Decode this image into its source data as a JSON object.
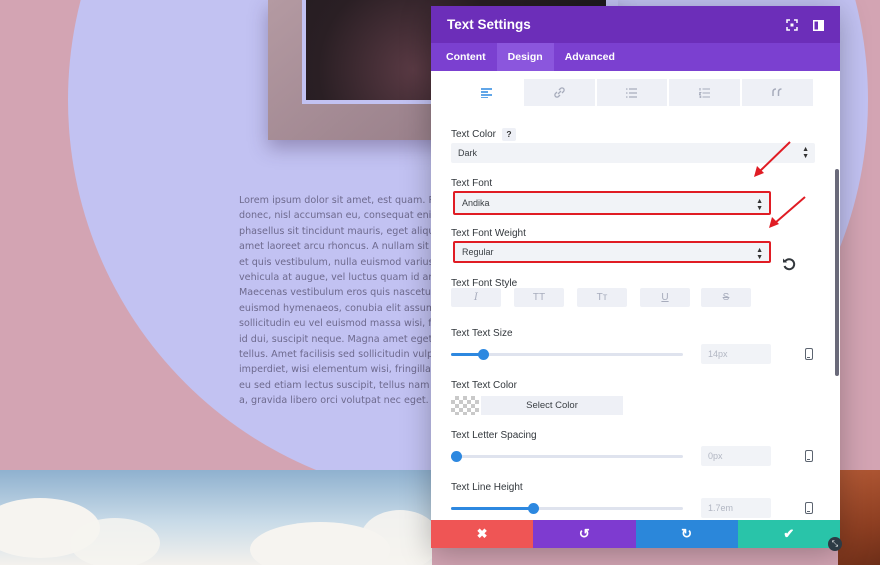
{
  "background": {
    "lorem_lines": [
      "Lorem ipsum dolor sit amet, est quam. Porta",
      "donec, nisl accumsan eu, consequat enim no",
      "phasellus sit tincidunt mauris, eget aliquam",
      "amet laoreet arcu rhoncus. A nullam sit cur",
      "et quis vestibulum, nulla euismod varius",
      "vehicula at augue, vel luctus quam id ante.",
      "Maecenas vestibulum eros quis nascetur",
      "euismod hymenaeos, conubia elit assumenda",
      "sollicitudin eu vel euismod massa wisi, facilis",
      "id dui, suscipit neque. Magna amet eget quam",
      "tellus. Amet facilisis sed sollicitudin vulputat",
      "imperdiet, wisi elementum wisi, fringilla solu",
      "eu sed etiam lectus suscipit, tellus nam non p",
      "a, gravida libero orci volutpat nec eget."
    ]
  },
  "modal": {
    "title": "Text Settings",
    "tabs": [
      {
        "label": "Content"
      },
      {
        "label": "Design"
      },
      {
        "label": "Advanced"
      }
    ],
    "active_tab": "Design",
    "subtab_icons": [
      "align-left-icon",
      "link-icon",
      "list-icon",
      "ordered-list-icon",
      "quote-icon"
    ],
    "text_color": {
      "label": "Text Color",
      "help": "?",
      "value": "Dark"
    },
    "text_font": {
      "label": "Text Font",
      "value": "Andika"
    },
    "text_font_weight": {
      "label": "Text Font Weight",
      "value": "Regular"
    },
    "text_font_style": {
      "label": "Text Font Style",
      "buttons": [
        "I",
        "TT",
        "Tт",
        "U",
        "S"
      ]
    },
    "text_size": {
      "label": "Text Text Size",
      "value": "14px",
      "fraction": 0.14
    },
    "text_text_color": {
      "label": "Text Text Color",
      "button": "Select Color"
    },
    "letter_spacing": {
      "label": "Text Letter Spacing",
      "value": "0px",
      "fraction": 0.02
    },
    "line_height": {
      "label": "Text Line Height",
      "value": "1.7em",
      "fraction": 0.355
    },
    "footer": {
      "cancel_icon": "✖",
      "undo_icon": "↺",
      "redo_icon": "↻",
      "save_icon": "✔"
    }
  },
  "colors": {
    "header": "#6c2eb9",
    "tab_bar": "#7b40d0",
    "accent": "#2d88e0",
    "highlight": "#e01c24",
    "cancel": "#ef5555",
    "undo": "#7e3bd0",
    "redo": "#2b87da",
    "save": "#29c4a9"
  }
}
